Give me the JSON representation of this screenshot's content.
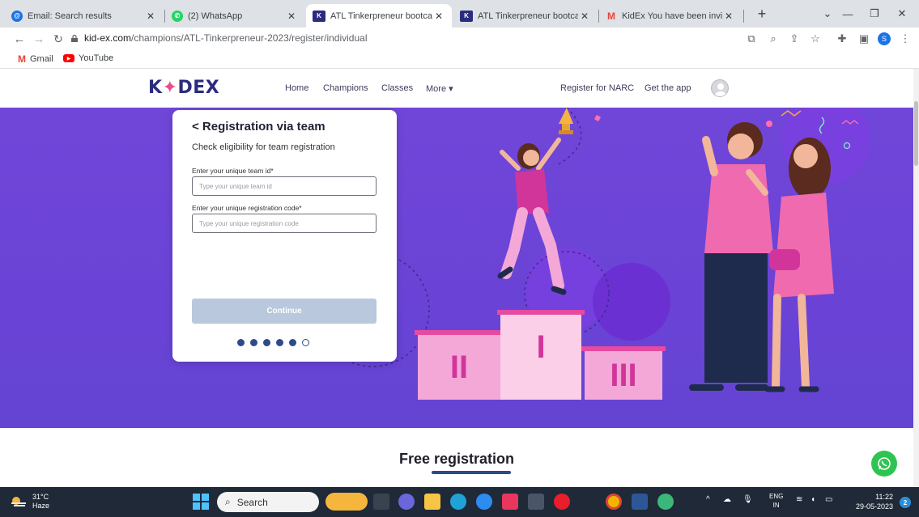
{
  "browser": {
    "tabs": [
      {
        "title": "Email: Search results",
        "favicon": "email-favicon",
        "color": "#1a73e8"
      },
      {
        "title": "(2) WhatsApp",
        "favicon": "whatsapp-favicon",
        "color": "#25d366"
      },
      {
        "title": "ATL Tinkerpreneur bootcamp",
        "favicon": "kidex-favicon",
        "color": "#2b2c7e",
        "active": true
      },
      {
        "title": "ATL Tinkerpreneur bootcamp",
        "favicon": "kidex-favicon",
        "color": "#2b2c7e"
      },
      {
        "title": "KidEx You have been invited",
        "favicon": "gmail-favicon",
        "color": "#ea4335"
      }
    ],
    "new_tab_label": "+",
    "url_host": "kid-ex.com",
    "url_path": "/champions/ATL-Tinkerpreneur-2023/register/individual",
    "profile_initial": "S",
    "bookmarks": [
      {
        "label": "Gmail",
        "icon": "gmail-icon"
      },
      {
        "label": "YouTube",
        "icon": "youtube-icon"
      }
    ]
  },
  "site": {
    "logo": {
      "left": "K",
      "mark": "✦",
      "right": "DEX"
    },
    "nav": {
      "home": "Home",
      "champions": "Champions",
      "classes": "Classes",
      "more": "More ▾",
      "register_narc": "Register for NARC",
      "get_app": "Get the app"
    }
  },
  "card": {
    "title": "< Registration via team",
    "subtitle": "Check eligibility for team registration",
    "team_id_label": "Enter your unique team id*",
    "team_id_placeholder": "Type your unique team id",
    "reg_code_label": "Enter your unique registration code*",
    "reg_code_placeholder": "Type your unique registration code",
    "continue_label": "Continue",
    "steps_total": 6,
    "steps_filled": 5
  },
  "podium": {
    "first": "I",
    "second": "II",
    "third": "III"
  },
  "section": {
    "free_registration": "Free registration"
  },
  "taskbar": {
    "temperature": "31°C",
    "weather": "Haze",
    "search": "Search",
    "lang_top": "ENG",
    "lang_bottom": "IN",
    "time": "11:22",
    "date": "29-05-2023",
    "notifications": "2"
  }
}
